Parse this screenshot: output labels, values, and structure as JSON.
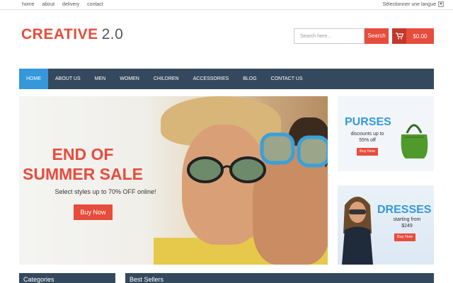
{
  "topbar": {
    "links": [
      "home",
      "about",
      "delivery",
      "contact"
    ],
    "language": "Sélectionner une langue"
  },
  "logo": {
    "part1": "CREATIVE",
    "part2": "2.0"
  },
  "search": {
    "placeholder": "Search here...",
    "button": "Search"
  },
  "cart": {
    "amount": "$0.00",
    "icon": "cart-icon"
  },
  "nav": [
    "HOME",
    "ABOUT US",
    "MEN",
    "WOMEN",
    "CHILDREN",
    "ACCESSORIES",
    "BLOG",
    "CONTACT US"
  ],
  "hero": {
    "line1": "END OF",
    "line2": "SUMMER SALE",
    "subtitle": "Select styles up to 70% OFF online!",
    "button": "Buy Now"
  },
  "promo_purses": {
    "title": "PURSES",
    "desc_line1": "discounts up to",
    "desc_line2": "55% off",
    "button": "Buy Now"
  },
  "promo_dresses": {
    "title": "DRESSES",
    "desc_line1": "starting from",
    "desc_line2": "$249",
    "button": "Buy Now"
  },
  "panels": {
    "categories": "Categories",
    "best_sellers": "Best Sellers"
  },
  "colors": {
    "accent": "#e74c3c",
    "nav_bg": "#34495e",
    "active": "#3498db"
  }
}
